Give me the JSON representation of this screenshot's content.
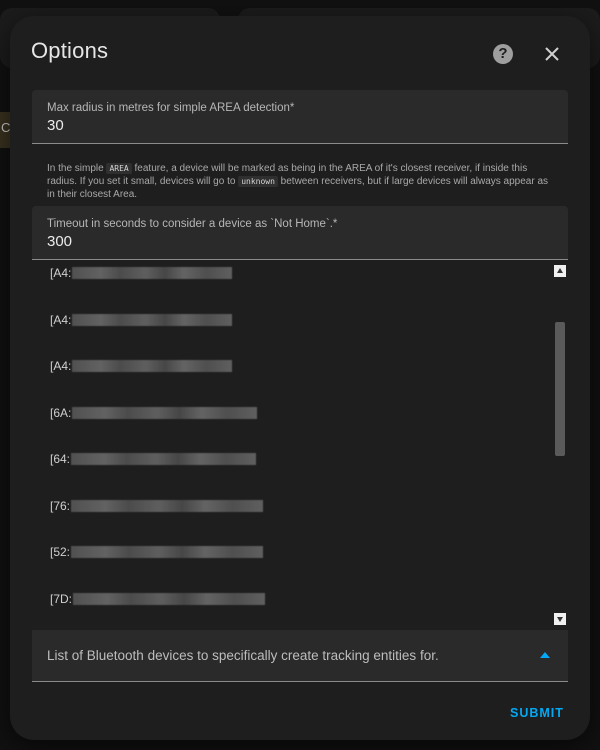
{
  "dialog": {
    "title": "Options",
    "help_icon": "help-circle-icon",
    "close_icon": "close-icon"
  },
  "background": {
    "partial_text": "C"
  },
  "fields": {
    "max_radius": {
      "label": "Max radius in metres for simple AREA detection*",
      "value": "30"
    },
    "timeout": {
      "label": "Timeout in seconds to consider a device as `Not Home`.*",
      "value": "300"
    }
  },
  "help": {
    "part1": "In the simple ",
    "code1": "AREA",
    "part2": " feature, a device will be marked as being in the AREA of it's closest receiver, if inside this radius. If you set it small, devices will go to ",
    "code2": "unknown",
    "part3": " between receivers, but if large devices will always appear as in their closest Area."
  },
  "devices": [
    {
      "prefix": "[A4:"
    },
    {
      "prefix": "[A4:"
    },
    {
      "prefix": "[A4:"
    },
    {
      "prefix": "[6A:"
    },
    {
      "prefix": "[64:"
    },
    {
      "prefix": "[76:"
    },
    {
      "prefix": "[52:"
    },
    {
      "prefix": "[7D:"
    }
  ],
  "dropdown": {
    "label": "List of Bluetooth devices to specifically create tracking entities for.",
    "icon": "chevron-up-icon"
  },
  "actions": {
    "submit": "SUBMIT"
  },
  "colors": {
    "accent": "#03a9f4",
    "dialog_bg": "#1e1e1e",
    "field_bg": "#2a2a2a"
  }
}
